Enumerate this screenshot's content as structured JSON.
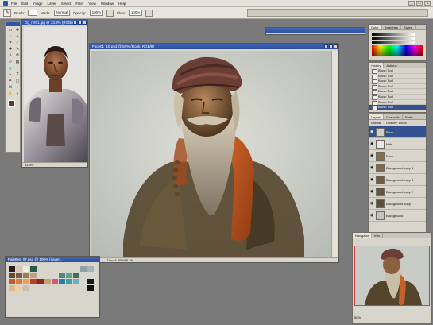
{
  "app": {
    "menu": [
      "File",
      "Edit",
      "Image",
      "Layer",
      "Select",
      "Filter",
      "View",
      "Window",
      "Help"
    ],
    "window_controls": [
      "_",
      "□",
      "x"
    ]
  },
  "options_bar": {
    "brush_label": "Brush:",
    "mode_label": "Mode:",
    "mode_value": "Normal",
    "opacity_label": "Opacity:",
    "opacity_value": "100%",
    "flow_label": "Flow:",
    "flow_value": "100%"
  },
  "ref_document": {
    "title": "Dg_ref01.jpg @ 33.3% (RGB/8)",
    "zoom": "33.3%"
  },
  "main_document": {
    "title": "Face01_10.psd @ 50% (Rook, RGB/8)",
    "zoom": "50%",
    "doc_info": "Doc: 6.00M/68.2M"
  },
  "swatches_window": {
    "title": "Palettes_07.psd @ 100% (Layer..."
  },
  "panels": {
    "color_tabs": [
      "Color",
      "Swatches",
      "Styles"
    ],
    "history_tabs": [
      "History",
      "Actions"
    ],
    "history_items": [
      "Brush Tool",
      "Brush Tool",
      "Brush Tool",
      "Brush Tool",
      "Brush Tool",
      "Brush Tool",
      "Brush Tool",
      "Brush Tool"
    ],
    "layers_tabs": [
      "Layers",
      "Channels",
      "Paths"
    ],
    "layer_blend": "Normal",
    "layer_opacity": "Opacity: 100%",
    "layers": [
      "Rook",
      "Hair",
      "Face",
      "Background copy 4",
      "Background copy 3",
      "Background copy 2",
      "Background copy",
      "Background"
    ],
    "navigator_tabs": [
      "Navigator",
      "Info"
    ],
    "navigator_zoom": "50%"
  },
  "colors": {
    "accent": "#2f55a4",
    "selection": "#33518f",
    "nav_frame": "#d63b3b"
  }
}
